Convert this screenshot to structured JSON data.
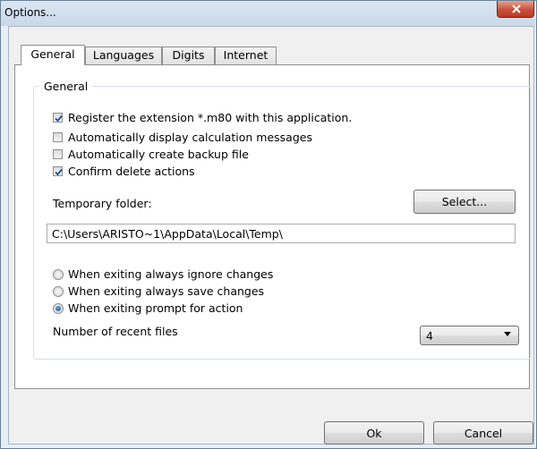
{
  "window": {
    "title": "Options..."
  },
  "tabs": [
    {
      "label": "General",
      "active": true
    },
    {
      "label": "Languages",
      "active": false
    },
    {
      "label": "Digits",
      "active": false
    },
    {
      "label": "Internet",
      "active": false
    }
  ],
  "general": {
    "group_title": "General",
    "checkboxes": [
      {
        "label": "Register the extension *.m80 with this application.",
        "checked": true
      },
      {
        "label": "Automatically display calculation messages",
        "checked": false
      },
      {
        "label": "Automatically create backup file",
        "checked": false
      },
      {
        "label": "Confirm delete actions",
        "checked": true
      }
    ],
    "temp_folder_label": "Temporary folder:",
    "select_button_label": "Select...",
    "temp_folder_value": "C:\\Users\\ARISTO~1\\AppData\\Local\\Temp\\",
    "exit_options": [
      {
        "label": "When exiting always ignore changes",
        "selected": false
      },
      {
        "label": "When exiting always save changes",
        "selected": false
      },
      {
        "label": "When exiting prompt for action",
        "selected": true
      }
    ],
    "recent_files_label": "Number of recent files",
    "recent_files_value": "4"
  },
  "buttons": {
    "ok_label": "Ok",
    "cancel_label": "Cancel"
  },
  "icons": {
    "close": "close-icon",
    "check": "checkmark-icon",
    "dropdown": "chevron-down-icon"
  },
  "colors": {
    "window_frame": "#6b7f96",
    "close_button": "#c9503a",
    "check_mark": "#1b4f8f"
  }
}
